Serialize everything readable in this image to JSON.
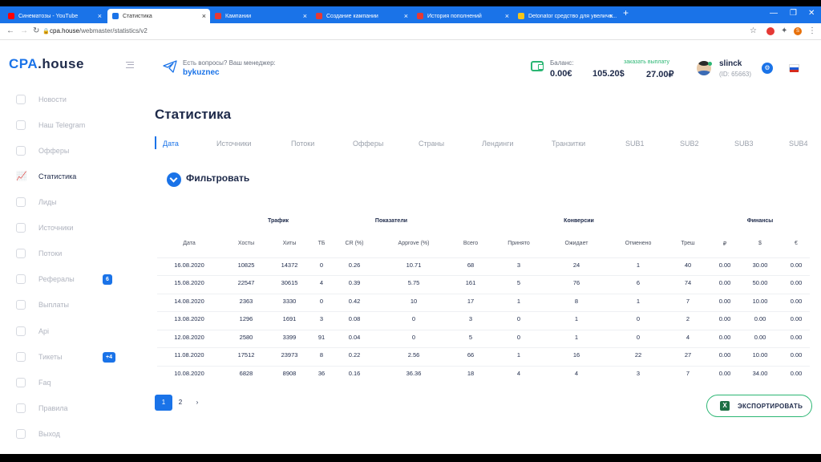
{
  "browser": {
    "tabs": [
      {
        "title": "Синематозы - YouTube",
        "favicon_color": "#ff0000"
      },
      {
        "title": "Статистика",
        "favicon_color": "#1a73e8"
      },
      {
        "title": "Кампании",
        "favicon_color": "#e53935"
      },
      {
        "title": "Создание кампании",
        "favicon_color": "#e53935"
      },
      {
        "title": "История пополнений",
        "favicon_color": "#e53935"
      },
      {
        "title": "Detonator средство для увеличе...",
        "favicon_color": "#f5c518"
      }
    ],
    "url_host": "cpa.house",
    "url_path": "/webmaster/statistics/v2",
    "profile_letter": "S"
  },
  "logo": {
    "main": "CPA",
    "suffix": ".house"
  },
  "sidebar": {
    "items": [
      {
        "label": "Новости"
      },
      {
        "label": "Наш Telegram"
      },
      {
        "label": "Офферы"
      },
      {
        "label": "Статистика"
      },
      {
        "label": "Лиды"
      },
      {
        "label": "Источники"
      },
      {
        "label": "Потоки"
      },
      {
        "label": "Рефералы",
        "badge": "6"
      },
      {
        "label": "Выплаты"
      },
      {
        "label": "Api"
      },
      {
        "label": "Тикеты",
        "badge": "+4"
      },
      {
        "label": "Faq"
      },
      {
        "label": "Правила"
      },
      {
        "label": "Выход"
      }
    ]
  },
  "header": {
    "manager_question": "Есть вопросы? Ваш менеджер:",
    "manager_name": "bykuznec",
    "balance_label": "Баланс:",
    "balances": [
      "0.00€",
      "105.20$",
      "27.00₽"
    ],
    "payout_link": "заказать выплату",
    "username": "slinck",
    "user_id": "(ID: 65663)",
    "gear_glyph": "⚙"
  },
  "main": {
    "title": "Статистика",
    "tabs": [
      "Дата",
      "Источники",
      "Потоки",
      "Офферы",
      "Страны",
      "Лендинги",
      "Транзитки",
      "SUB1",
      "SUB2",
      "SUB3",
      "SUB4"
    ],
    "filter_label": "Фильтровать"
  },
  "table": {
    "groups": [
      "Трафик",
      "Показатели",
      "Конверсии",
      "Финансы"
    ],
    "columns": [
      "Дата",
      "Хосты",
      "Хиты",
      "ТБ",
      "CR (%)",
      "Approve (%)",
      "Всего",
      "Принято",
      "Ожидает",
      "Отменено",
      "Треш",
      "₽",
      "$",
      "€"
    ],
    "rows": [
      [
        "16.08.2020",
        "10825",
        "14372",
        "0",
        "0.26",
        "10.71",
        "68",
        "3",
        "24",
        "1",
        "40",
        "0.00",
        "30.00",
        "0.00"
      ],
      [
        "15.08.2020",
        "22547",
        "30615",
        "4",
        "0.39",
        "5.75",
        "161",
        "5",
        "76",
        "6",
        "74",
        "0.00",
        "50.00",
        "0.00"
      ],
      [
        "14.08.2020",
        "2363",
        "3330",
        "0",
        "0.42",
        "10",
        "17",
        "1",
        "8",
        "1",
        "7",
        "0.00",
        "10.00",
        "0.00"
      ],
      [
        "13.08.2020",
        "1296",
        "1691",
        "3",
        "0.08",
        "0",
        "3",
        "0",
        "1",
        "0",
        "2",
        "0.00",
        "0.00",
        "0.00"
      ],
      [
        "12.08.2020",
        "2580",
        "3399",
        "91",
        "0.04",
        "0",
        "5",
        "0",
        "1",
        "0",
        "4",
        "0.00",
        "0.00",
        "0.00"
      ],
      [
        "11.08.2020",
        "17512",
        "23973",
        "8",
        "0.22",
        "2.56",
        "66",
        "1",
        "16",
        "22",
        "27",
        "0.00",
        "10.00",
        "0.00"
      ],
      [
        "10.08.2020",
        "6828",
        "8908",
        "36",
        "0.16",
        "36.36",
        "18",
        "4",
        "4",
        "3",
        "7",
        "0.00",
        "34.00",
        "0.00"
      ]
    ]
  },
  "pagination": {
    "pages": [
      "1",
      "2"
    ],
    "next": "›"
  },
  "export": {
    "label": "ЭКСПОРТИРОВАТЬ",
    "icon_letter": "X"
  },
  "colors": {
    "accent": "#1a73e8",
    "success": "#2bb673",
    "text_dark": "#1e2a4a"
  }
}
